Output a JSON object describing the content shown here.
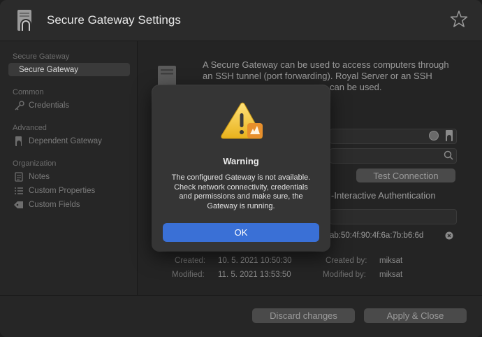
{
  "window": {
    "title": "Secure Gateway Settings"
  },
  "sidebar": {
    "sections": [
      {
        "label": "Secure Gateway",
        "items": [
          {
            "label": "Secure Gateway",
            "selected": true
          }
        ]
      },
      {
        "label": "Common",
        "items": [
          {
            "label": "Credentials"
          }
        ]
      },
      {
        "label": "Advanced",
        "items": [
          {
            "label": "Dependent Gateway"
          }
        ]
      },
      {
        "label": "Organization",
        "items": [
          {
            "label": "Notes"
          },
          {
            "label": "Custom Properties"
          },
          {
            "label": "Custom Fields"
          }
        ]
      }
    ]
  },
  "main": {
    "description": "A Secure Gateway can be used to access computers through an SSH tunnel (port forwarding). Royal Server or an SSH ... can be used.",
    "description_line1": "A Secure Gateway can be used to access computers through",
    "description_line2": "an SSH tunnel (port forwarding). Royal Server or an SSH",
    "description_line3": "can be used.",
    "test_connection_label": "Test Connection",
    "interactive_auth_label": "-Interactive Authentication",
    "fingerprint": "ab:50:4f:90:4f:6a:7b:b6:6d",
    "created_label": "Created:",
    "created_value": "10. 5. 2021 10:50:30",
    "created_by_label": "Created by:",
    "created_by_value": "miksat",
    "modified_label": "Modified:",
    "modified_value": "11. 5. 2021 13:53:50",
    "modified_by_label": "Modified by:",
    "modified_by_value": "miksat"
  },
  "footer": {
    "discard_label": "Discard changes",
    "apply_label": "Apply & Close"
  },
  "dialog": {
    "title": "Warning",
    "message": "The configured Gateway is not available. Check network connectivity, credentials and permissions and make sure, the Gateway is running.",
    "message_lines": [
      "The configured Gateway is not available.",
      "Check network connectivity, credentials",
      "and permissions and make sure, the",
      "Gateway is running."
    ],
    "ok_label": "OK"
  },
  "colors": {
    "accent": "#3a70d6",
    "warning": "#f5c542",
    "badge": "#e8902c"
  }
}
